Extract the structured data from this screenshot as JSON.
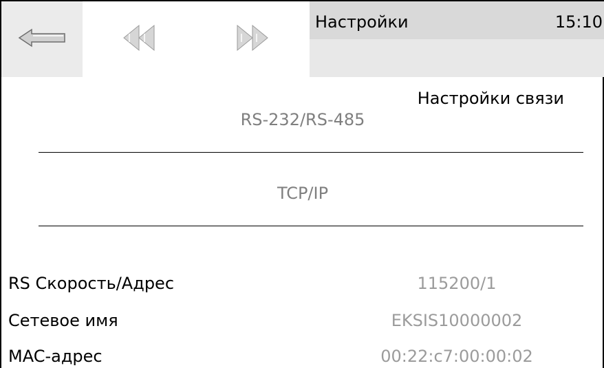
{
  "header": {
    "title": "Настройки",
    "time": "15:10",
    "subtitle": "Настройки связи"
  },
  "nav": {
    "back_icon": "arrow-left-icon",
    "prev_icon": "double-left-triangle-icon",
    "next_icon": "double-right-triangle-icon"
  },
  "menu": {
    "items": [
      {
        "label": "RS-232/RS-485"
      },
      {
        "label": "TCP/IP"
      }
    ]
  },
  "info": {
    "rows": [
      {
        "label": "RS Скорость/Адрес",
        "value": "115200/1"
      },
      {
        "label": "Сетевое имя",
        "value": "EKSIS10000002"
      },
      {
        "label": "MAC-адрес",
        "value": "00:22:c7:00:00:02"
      }
    ]
  },
  "colors": {
    "header_bg": "#d9d9d9",
    "subheader_bg": "#e8e8e8",
    "back_bg": "#ebebeb",
    "menu_text": "#7f7f7f",
    "value_text": "#9b9b9b"
  }
}
